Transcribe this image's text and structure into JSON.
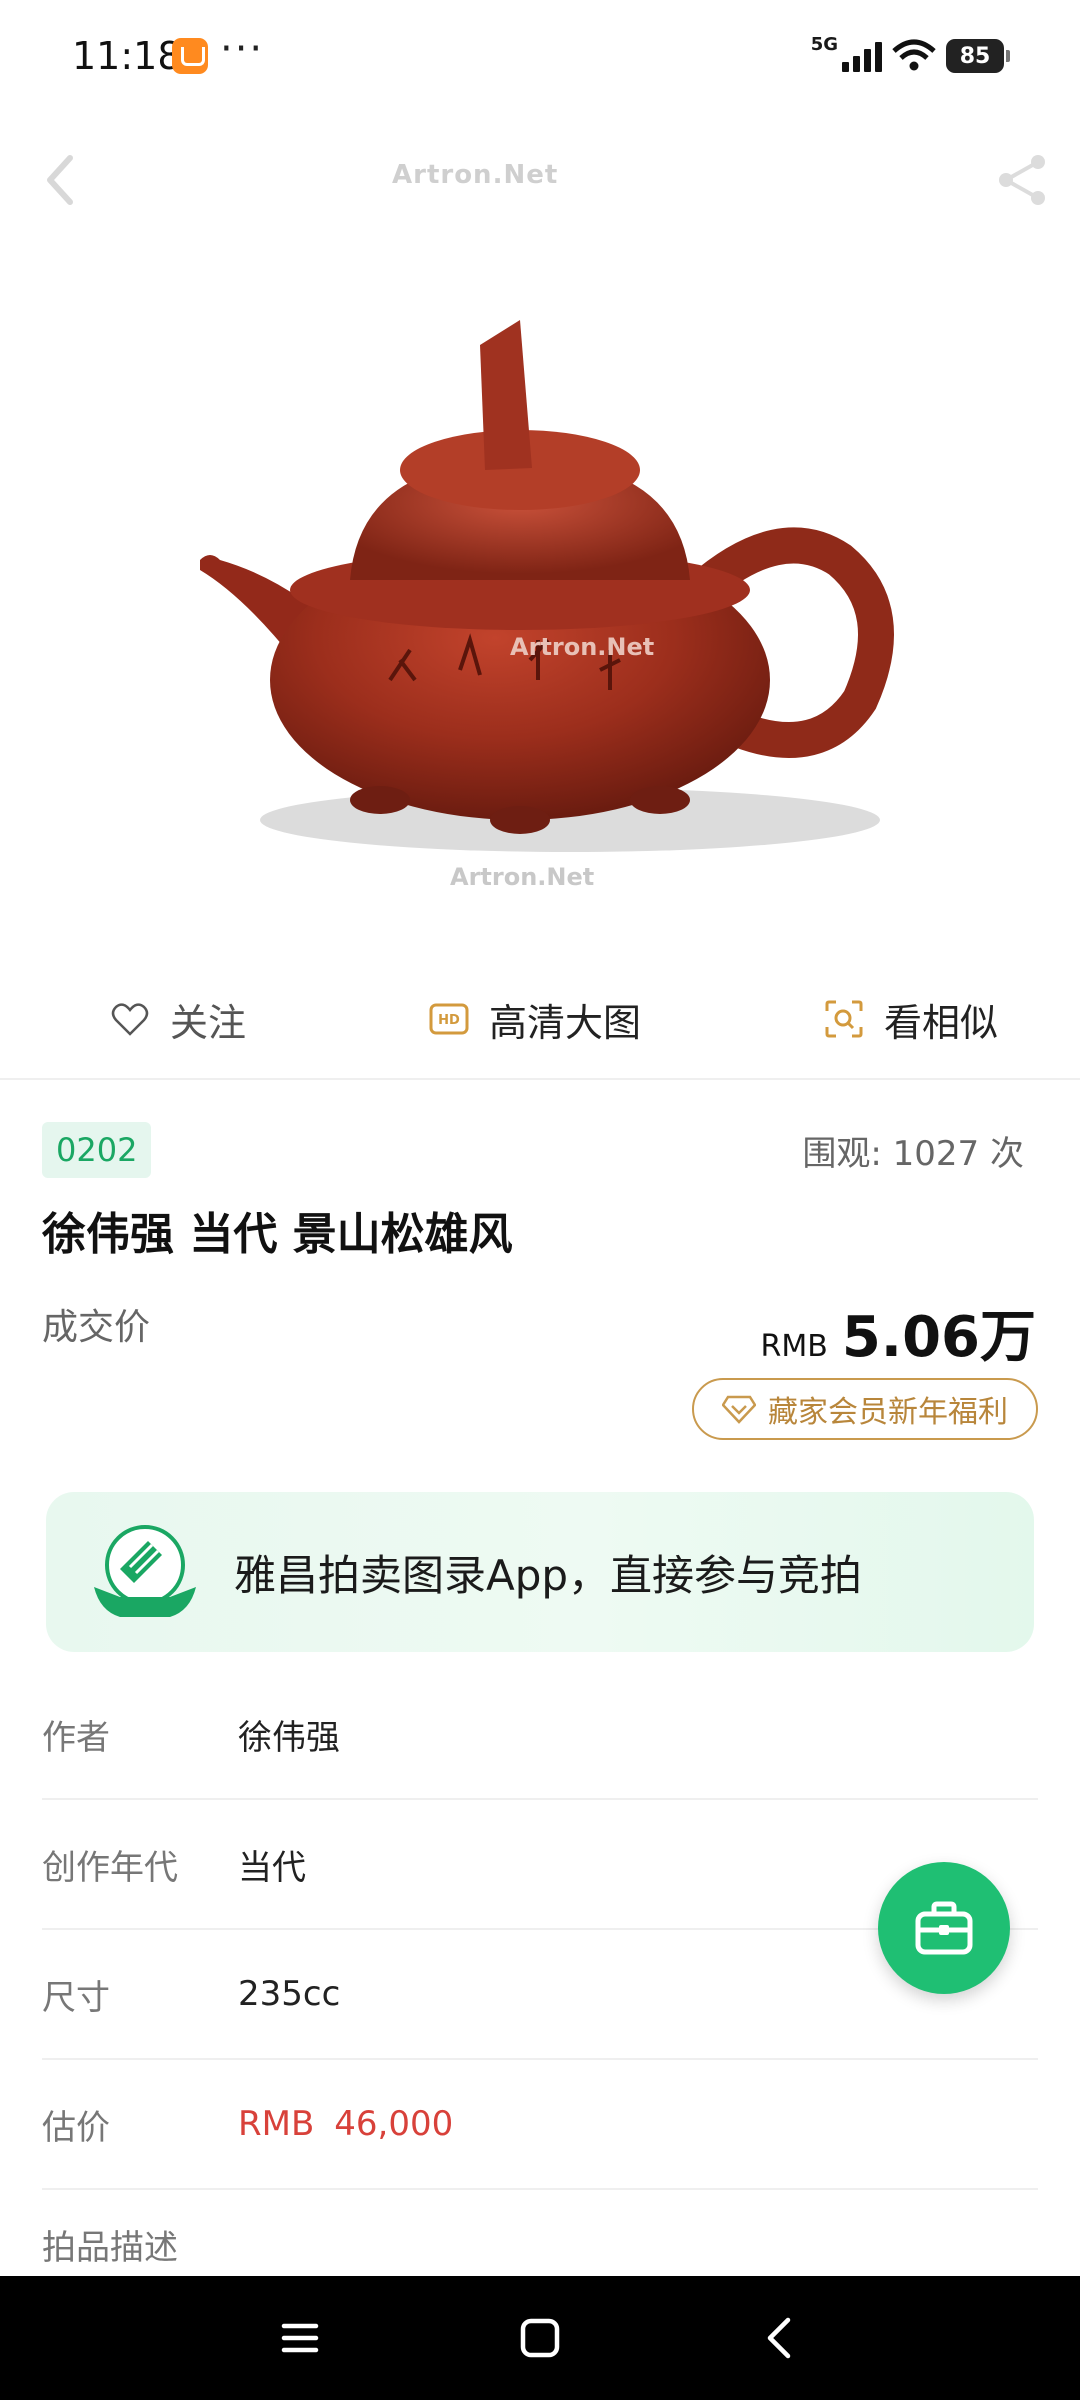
{
  "status_bar": {
    "time": "11:18",
    "app_icon": "notification-app-icon",
    "more": "···",
    "network": "5G",
    "battery": "85"
  },
  "hero": {
    "watermark": "Artron.Net",
    "image": "red-clay-teapot"
  },
  "actions": {
    "follow": "关注",
    "hd": "高清大图",
    "similar": "看相似"
  },
  "lot": {
    "number": "0202",
    "views": "围观:  1027  次",
    "title": "徐伟强 当代 景山松雄风",
    "price_label": "成交价",
    "currency": "RMB",
    "price": "5.06万",
    "vip_button": "藏家会员新年福利"
  },
  "banner": {
    "text": "雅昌拍卖图录App，直接参与竞拍"
  },
  "details": {
    "author_label": "作者",
    "author": "徐伟强",
    "era_label": "创作年代",
    "era": "当代",
    "size_label": "尺寸",
    "size": "235cc",
    "estimate_label": "估价",
    "estimate_currency": "RMB",
    "estimate": "46,000",
    "desc_label": "拍品描述"
  },
  "colors": {
    "accent_green": "#1fbf73",
    "estimate_red": "#d8413a",
    "vip_gold": "#c99a4e"
  }
}
